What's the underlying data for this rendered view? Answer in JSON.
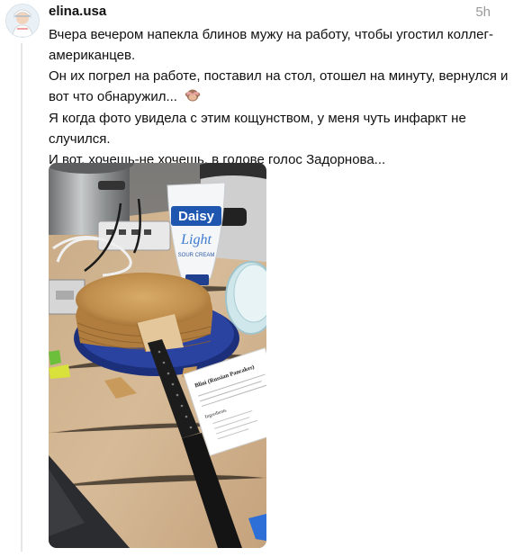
{
  "post": {
    "username": "elina.usa",
    "time": "5h",
    "lines": [
      "Вчера вечером напекла блинов мужу на работу, чтобы угостил коллег-американцев.",
      "Он их погрел на работе, поставил на стол, отошел на минуту, вернулся и вот что обнаружил... ",
      "Я когда фото увидела с этим кощунством, у меня чуть инфаркт не случился.",
      "И вот, хочешь-не хочешь, в голове голос Задорнова..."
    ],
    "emoji_icon": "see-no-evil-monkey-icon"
  },
  "photo": {
    "sour_cream_brand": "Daisy",
    "sour_cream_variant": "Light",
    "sour_cream_label": "SOUR CREAM",
    "recipe_title": "Blini (Russian Pancakes)",
    "recipe_section": "Ingredients"
  }
}
